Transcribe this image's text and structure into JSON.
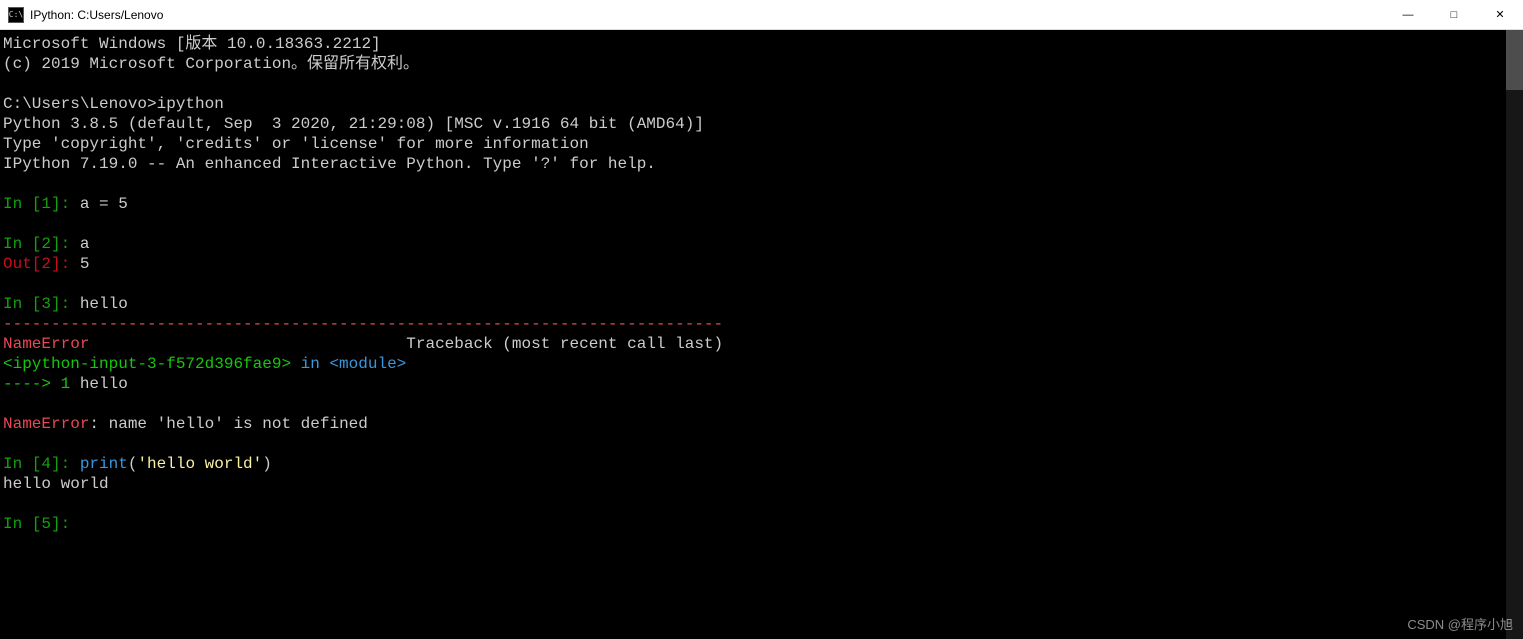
{
  "window": {
    "icon_text": "C:\\",
    "title": "IPython: C:Users/Lenovo",
    "controls": {
      "min": "—",
      "max": "□",
      "close": "✕"
    }
  },
  "header": {
    "line1": "Microsoft Windows [版本 10.0.18363.2212]",
    "line2": "(c) 2019 Microsoft Corporation。保留所有权利。"
  },
  "cmd": {
    "prompt": "C:\\Users\\Lenovo>",
    "command": "ipython"
  },
  "ipython_banner": {
    "line1": "Python 3.8.5 (default, Sep  3 2020, 21:29:08) [MSC v.1916 64 bit (AMD64)]",
    "line2": "Type 'copyright', 'credits' or 'license' for more information",
    "line3": "IPython 7.19.0 -- An enhanced Interactive Python. Type '?' for help."
  },
  "session": {
    "in1": {
      "prompt": "In [1]: ",
      "code": "a = 5"
    },
    "in2": {
      "prompt": "In [2]: ",
      "code": "a"
    },
    "out2": {
      "prompt": "Out[2]: ",
      "value": "5"
    },
    "in3": {
      "prompt": "In [3]: ",
      "code": "hello"
    },
    "traceback": {
      "rule": "---------------------------------------------------------------------------",
      "err_name": "NameError",
      "tb_label": "                                 Traceback (most recent call last)",
      "src_ref": "<ipython-input-3-f572d396fae9>",
      "in_word": " in ",
      "module": "<module>",
      "arrow": "----> 1",
      "arrow_code": " hello",
      "final_err": "NameError",
      "final_msg": ": name 'hello' is not defined"
    },
    "in4": {
      "prompt": "In [4]: ",
      "fn": "print",
      "paren_l": "(",
      "str": "'hello world'",
      "paren_r": ")"
    },
    "out4_text": "hello world",
    "in5": {
      "prompt": "In [5]: "
    }
  },
  "watermark": "CSDN @程序小旭"
}
